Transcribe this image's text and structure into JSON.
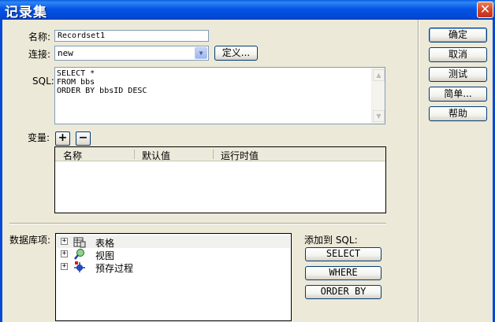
{
  "window": {
    "title": "记录集",
    "close_glyph": "✕"
  },
  "form": {
    "name_label": "名称:",
    "name_value": "Recordset1",
    "connection_label": "连接:",
    "connection_value": "new",
    "define_button": "定义...",
    "sql_label": "SQL:",
    "sql_text": "SELECT *\nFROM bbs\nORDER BY bbsID DESC",
    "variables_label": "变量:",
    "add_glyph": "+",
    "remove_glyph": "−"
  },
  "variables_table": {
    "columns": [
      "名称",
      "默认值",
      "运行时值"
    ],
    "rows": []
  },
  "database": {
    "label": "数据库项:",
    "items": [
      {
        "label": "表格",
        "icon": "table-icon"
      },
      {
        "label": "视图",
        "icon": "view-icon"
      },
      {
        "label": "预存过程",
        "icon": "stored-procedure-icon"
      }
    ],
    "expander_glyph": "+"
  },
  "add_to_sql": {
    "label": "添加到 SQL:",
    "select_button": "SELECT",
    "where_button": "WHERE",
    "orderby_button": "ORDER BY"
  },
  "side_buttons": {
    "ok": "确定",
    "cancel": "取消",
    "test": "测试",
    "simple": "简单...",
    "help": "帮助"
  },
  "colors": {
    "titlebar": "#0554e4",
    "dialog_bg": "#ece9d8",
    "button_border": "#003c74"
  }
}
